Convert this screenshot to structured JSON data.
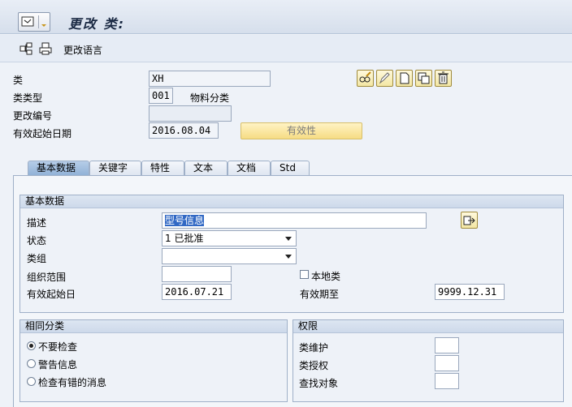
{
  "title": {
    "text": "更改 类:"
  },
  "toolbar": {
    "lang_label": "更改语言"
  },
  "header": {
    "class_label": "类",
    "class_value": "XH",
    "class_type_label": "类类型",
    "class_type_value": "001",
    "class_type_desc": "物料分类",
    "change_no_label": "更改编号",
    "change_no_value": "",
    "valid_from_label": "有效起始日期",
    "valid_from_value": "2016.08.04",
    "validity_button": "有效性"
  },
  "tabs": [
    "基本数据",
    "关键字",
    "特性",
    "文本",
    "文档",
    "Std"
  ],
  "basic": {
    "group_title": "基本数据",
    "desc_label": "描述",
    "desc_value": "型号信息",
    "status_label": "状态",
    "status_value": "1 已批准",
    "class_group_label": "类组",
    "class_group_value": "",
    "org_area_label": "组织范围",
    "org_area_value": "",
    "local_class_label": "本地类",
    "valid_from_label": "有效起始日",
    "valid_from_value": "2016.07.21",
    "valid_to_label": "有效期至",
    "valid_to_value": "9999.12.31"
  },
  "same_class": {
    "group_title": "相同分类",
    "options": [
      "不要检查",
      "警告信息",
      "检查有错的消息"
    ]
  },
  "auth": {
    "group_title": "权限",
    "maint_label": "类维护",
    "grant_label": "类授权",
    "find_label": "查找对象"
  }
}
